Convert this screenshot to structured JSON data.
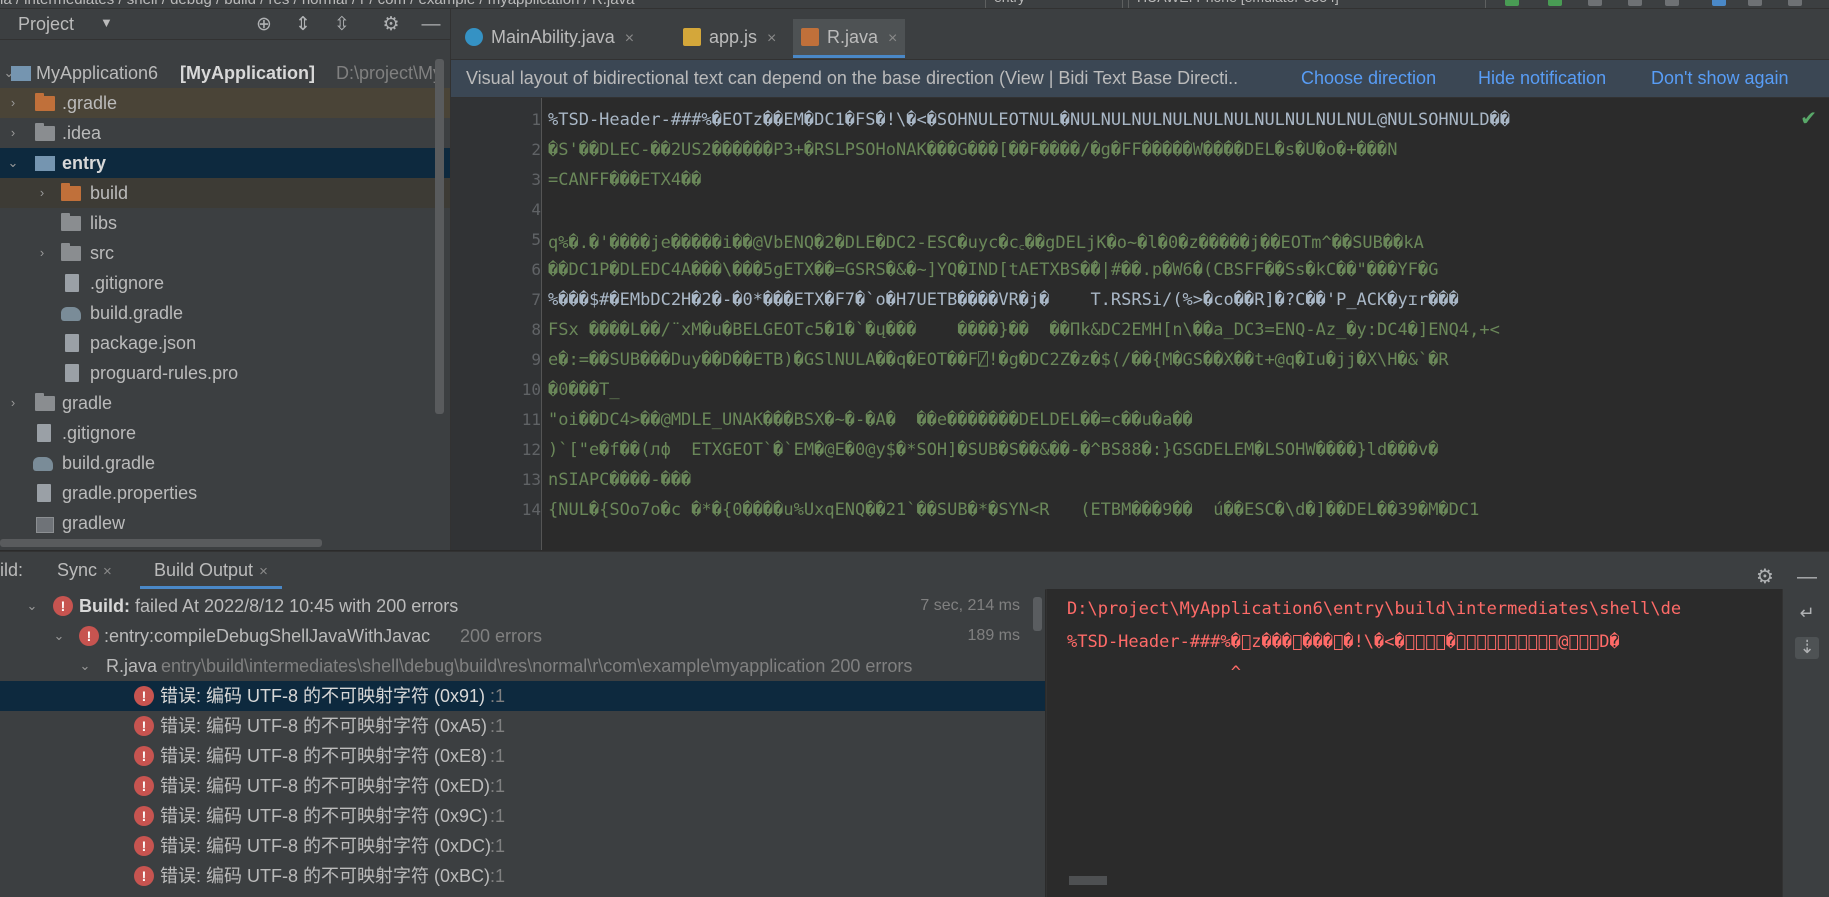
{
  "topbar": {
    "breadcrumb": "ia / intermediates / shell / debug / build / res / normal / r / com / example / myapplication / R.java",
    "run_config": "entry",
    "device": "HUAWEI Phone [emulator-5554]"
  },
  "project_panel": {
    "title": "Project",
    "root": {
      "name": "MyApplication6",
      "module": "[MyApplication]",
      "path": "D:\\project\\My"
    },
    "items": [
      {
        "label": ".gradle"
      },
      {
        "label": ".idea"
      },
      {
        "label": "entry"
      },
      {
        "label": "build"
      },
      {
        "label": "libs"
      },
      {
        "label": "src"
      },
      {
        "label": ".gitignore"
      },
      {
        "label": "build.gradle"
      },
      {
        "label": "package.json"
      },
      {
        "label": "proguard-rules.pro"
      },
      {
        "label": "gradle"
      },
      {
        "label": ".gitignore"
      },
      {
        "label": "build.gradle"
      },
      {
        "label": "gradle.properties"
      },
      {
        "label": "gradlew"
      }
    ]
  },
  "editor": {
    "tabs": [
      {
        "label": "MainAbility.java"
      },
      {
        "label": "app.js"
      },
      {
        "label": "R.java"
      }
    ],
    "banner": {
      "message": "Visual layout of bidirectional text can depend on the base direction (View | Bidi Text Base Directi..",
      "choose": "Choose direction",
      "hide": "Hide notification",
      "dont_show": "Don't show again"
    },
    "line_numbers": [
      "1",
      "2",
      "3",
      "4",
      "5",
      "6",
      "7",
      "8",
      "9",
      "10",
      "11",
      "12",
      "13",
      "14"
    ],
    "lines": [
      "%TSD-Header-###%�EOTz��EM�DC1�FS�!\\�<�SOHNULEOTNUL�NULNULNULNULNULNULNULNULNULNUL@NULSOHNULD��",
      "�S'��DLEC-��2US2������P3+�RSLPSOHoNAK���G���[��F����/�g�FF�����W����DEL�s�U�o�+���N",
      "=CANFF���ETX4��",
      "",
      "q%�.�'����je�����i��@VbENQ�2�DLE�DC2-ESC�uyc�c꜀��gDELjK�o~�l�0�z�����j��EOTm^��SUB��kA",
      "��DC1P�DLEDC4A���\\���5gETX��=GSRS�&�~]YQ�IND[tAETXBS�̂�|#��.p�W6�(CBSFF��Ss�kC��\"���YF�G",
      "%���$#�EMbDC2H�2�-�0*���ETX�F7�`o�H7UETB����VR�j�    T.RSRSi/(%>�co��R]�?C��'P_ACK�yɪr���",
      "FSx ����L��/¨xM�u�BELGEOTc5�1�`�ų���    ����}��  ��Πk&DC2EMH[n\\��a_DC3=ENQ-Az_�y:DC4�]ENQ4,+<",
      "e�:=��SUB���Duy��D��ETB)�GSlNULA��q�EOT��F⍁!�g�DC2Z�z�$⟨/��{M�GS��X��t+@q�Iu�jj�X\\H�&`�R",
      "�0���T_",
      "\"oi��DC4>��@MDLE_UNAK���BSX�~�-�A�  ��e�������DELDEL��=c��u�a��",
      ")`[\"e�f��(лф  ETXGEOT`�`EM�@E�0@y$�*SOH]�SUB�S��&��-�^BS88�:}GSGDELEM�LSOHW����}ld���v�",
      "nSIAPC����-���",
      "{NUL�{SOo7o�c �*�{0����u%UxqENQ��21`��SUB�*�SYN<R   (ETBM���9��  ú��ESC�\\d�]��DEL��39�M�DC1"
    ]
  },
  "build_panel": {
    "label": "ild:",
    "tabs": [
      {
        "label": "Sync"
      },
      {
        "label": "Build Output"
      }
    ],
    "rows": [
      {
        "title": "Build:",
        "text": "failed At 2022/8/12 10:45 with 200 errors",
        "time": "7 sec, 214 ms"
      },
      {
        "title": ":entry:compileDebugShellJavaWithJavac",
        "text": "200 errors",
        "time": "189 ms"
      },
      {
        "title": "R.java",
        "text": "entry\\build\\intermediates\\shell\\debug\\build\\res\\normal\\r\\com\\example\\myapplication 200 errors",
        "time": ""
      }
    ],
    "errors": [
      {
        "text": "错误: 编码 UTF-8 的不可映射字符 (0x91)",
        "loc": ":1"
      },
      {
        "text": "错误: 编码 UTF-8 的不可映射字符 (0xA5)",
        "loc": ":1"
      },
      {
        "text": "错误: 编码 UTF-8 的不可映射字符 (0xE8)",
        "loc": ":1"
      },
      {
        "text": "错误: 编码 UTF-8 的不可映射字符 (0xED)",
        "loc": ":1"
      },
      {
        "text": "错误: 编码 UTF-8 的不可映射字符 (0x9C)",
        "loc": ":1"
      },
      {
        "text": "错误: 编码 UTF-8 的不可映射字符 (0xDC)",
        "loc": ":1"
      },
      {
        "text": "错误: 编码 UTF-8 的不可映射字符 (0xBC)",
        "loc": ":1"
      }
    ],
    "console": [
      "D:\\project\\MyApplication6\\entry\\build\\intermediates\\shell\\de",
      "%TSD-Header-###%�\u0000z���\u0000���\u0000�!\\�<�\u0000\u0000\u0000\u0000�\u0000\u0000\u0000\u0000\u0000\u0000\u0000\u0000\u0000\u0000@\u0000\u0000\u0000D�",
      "                ^"
    ]
  },
  "colors": {
    "panel_bg": "#3c3f41",
    "editor_bg": "#2b2b2b",
    "selection": "#0d293e",
    "link": "#589df6",
    "error": "#c75450",
    "string_green": "#6a8759"
  }
}
